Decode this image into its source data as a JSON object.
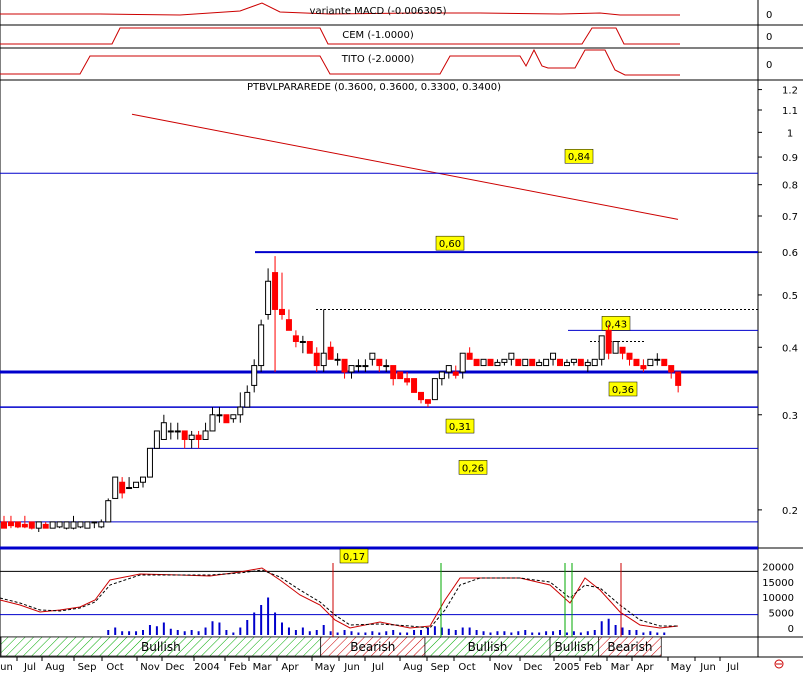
{
  "indicators": [
    {
      "label": "variante MACD (-0.006305)",
      "value": "0"
    },
    {
      "label": "CEM (-1.0000)",
      "value": "0"
    },
    {
      "label": "TITO (-2.0000)",
      "value": "0"
    }
  ],
  "chart_data": {
    "type": "candlestick",
    "title": "PTBVLPARAREDE (0.3600, 0.3600, 0.3300, 0.3400)",
    "y_scale": "log",
    "ylim": [
      0.17,
      1.25
    ],
    "y_ticks": [
      "1.2",
      "1.1",
      "1",
      "0.9",
      "0.8",
      "0.7",
      "0.6",
      "0.5",
      "0.4",
      "0.3",
      "0.2"
    ],
    "x_labels": [
      "Jun",
      "Jul",
      "Aug",
      "Sep",
      "Oct",
      "Nov",
      "Dec",
      "2004",
      "Feb",
      "Mar",
      "Apr",
      "May",
      "Jun",
      "Jul",
      "Aug",
      "Sep",
      "Oct",
      "Nov",
      "Dec",
      "2005",
      "Feb",
      "Mar",
      "Apr",
      "May",
      "Jun",
      "Jul"
    ],
    "level_labels": [
      "0,84",
      "0,60",
      "0,43",
      "0,36",
      "0,31",
      "0,26",
      "0,17"
    ],
    "candles": [
      {
        "o": 0.19,
        "h": 0.195,
        "l": 0.185,
        "c": 0.185
      },
      {
        "o": 0.19,
        "h": 0.195,
        "l": 0.185,
        "c": 0.187
      },
      {
        "o": 0.19,
        "h": 0.19,
        "l": 0.185,
        "c": 0.186
      },
      {
        "o": 0.188,
        "h": 0.195,
        "l": 0.185,
        "c": 0.186
      },
      {
        "o": 0.19,
        "h": 0.19,
        "l": 0.184,
        "c": 0.185
      },
      {
        "o": 0.185,
        "h": 0.19,
        "l": 0.182,
        "c": 0.19
      },
      {
        "o": 0.188,
        "h": 0.19,
        "l": 0.185,
        "c": 0.185
      },
      {
        "o": 0.185,
        "h": 0.19,
        "l": 0.185,
        "c": 0.19
      },
      {
        "o": 0.186,
        "h": 0.19,
        "l": 0.185,
        "c": 0.19
      },
      {
        "o": 0.185,
        "h": 0.19,
        "l": 0.184,
        "c": 0.19
      },
      {
        "o": 0.185,
        "h": 0.195,
        "l": 0.184,
        "c": 0.19
      },
      {
        "o": 0.186,
        "h": 0.19,
        "l": 0.185,
        "c": 0.19
      },
      {
        "o": 0.185,
        "h": 0.19,
        "l": 0.185,
        "c": 0.19
      },
      {
        "o": 0.19,
        "h": 0.19,
        "l": 0.185,
        "c": 0.19
      },
      {
        "o": 0.186,
        "h": 0.192,
        "l": 0.185,
        "c": 0.19
      },
      {
        "o": 0.19,
        "h": 0.21,
        "l": 0.19,
        "c": 0.208
      },
      {
        "o": 0.21,
        "h": 0.23,
        "l": 0.21,
        "c": 0.23
      },
      {
        "o": 0.225,
        "h": 0.23,
        "l": 0.21,
        "c": 0.215
      },
      {
        "o": 0.22,
        "h": 0.23,
        "l": 0.22,
        "c": 0.22
      },
      {
        "o": 0.22,
        "h": 0.225,
        "l": 0.22,
        "c": 0.225
      },
      {
        "o": 0.225,
        "h": 0.23,
        "l": 0.22,
        "c": 0.23
      },
      {
        "o": 0.23,
        "h": 0.26,
        "l": 0.23,
        "c": 0.26
      },
      {
        "o": 0.26,
        "h": 0.28,
        "l": 0.26,
        "c": 0.28
      },
      {
        "o": 0.27,
        "h": 0.3,
        "l": 0.27,
        "c": 0.29
      },
      {
        "o": 0.28,
        "h": 0.29,
        "l": 0.27,
        "c": 0.28
      },
      {
        "o": 0.28,
        "h": 0.29,
        "l": 0.27,
        "c": 0.28
      },
      {
        "o": 0.28,
        "h": 0.28,
        "l": 0.26,
        "c": 0.27
      },
      {
        "o": 0.27,
        "h": 0.28,
        "l": 0.26,
        "c": 0.275
      },
      {
        "o": 0.275,
        "h": 0.28,
        "l": 0.26,
        "c": 0.27
      },
      {
        "o": 0.27,
        "h": 0.29,
        "l": 0.27,
        "c": 0.28
      },
      {
        "o": 0.28,
        "h": 0.31,
        "l": 0.28,
        "c": 0.3
      },
      {
        "o": 0.3,
        "h": 0.31,
        "l": 0.29,
        "c": 0.3
      },
      {
        "o": 0.3,
        "h": 0.3,
        "l": 0.29,
        "c": 0.29
      },
      {
        "o": 0.295,
        "h": 0.3,
        "l": 0.29,
        "c": 0.3
      },
      {
        "o": 0.3,
        "h": 0.33,
        "l": 0.29,
        "c": 0.31
      },
      {
        "o": 0.31,
        "h": 0.34,
        "l": 0.31,
        "c": 0.33
      },
      {
        "o": 0.34,
        "h": 0.38,
        "l": 0.33,
        "c": 0.37
      },
      {
        "o": 0.37,
        "h": 0.45,
        "l": 0.36,
        "c": 0.44
      },
      {
        "o": 0.46,
        "h": 0.56,
        "l": 0.45,
        "c": 0.53
      },
      {
        "o": 0.55,
        "h": 0.59,
        "l": 0.36,
        "c": 0.47
      },
      {
        "o": 0.47,
        "h": 0.55,
        "l": 0.45,
        "c": 0.46
      },
      {
        "o": 0.45,
        "h": 0.47,
        "l": 0.43,
        "c": 0.43
      },
      {
        "o": 0.42,
        "h": 0.43,
        "l": 0.4,
        "c": 0.41
      },
      {
        "o": 0.41,
        "h": 0.42,
        "l": 0.39,
        "c": 0.41
      },
      {
        "o": 0.41,
        "h": 0.41,
        "l": 0.39,
        "c": 0.39
      },
      {
        "o": 0.39,
        "h": 0.4,
        "l": 0.36,
        "c": 0.37
      },
      {
        "o": 0.37,
        "h": 0.47,
        "l": 0.36,
        "c": 0.39
      },
      {
        "o": 0.4,
        "h": 0.41,
        "l": 0.38,
        "c": 0.38
      },
      {
        "o": 0.38,
        "h": 0.39,
        "l": 0.37,
        "c": 0.38
      },
      {
        "o": 0.38,
        "h": 0.38,
        "l": 0.35,
        "c": 0.36
      },
      {
        "o": 0.36,
        "h": 0.37,
        "l": 0.35,
        "c": 0.37
      },
      {
        "o": 0.37,
        "h": 0.38,
        "l": 0.36,
        "c": 0.37
      },
      {
        "o": 0.37,
        "h": 0.38,
        "l": 0.36,
        "c": 0.37
      },
      {
        "o": 0.38,
        "h": 0.39,
        "l": 0.37,
        "c": 0.39
      },
      {
        "o": 0.38,
        "h": 0.38,
        "l": 0.36,
        "c": 0.37
      },
      {
        "o": 0.37,
        "h": 0.38,
        "l": 0.36,
        "c": 0.37
      },
      {
        "o": 0.37,
        "h": 0.37,
        "l": 0.34,
        "c": 0.35
      },
      {
        "o": 0.36,
        "h": 0.36,
        "l": 0.35,
        "c": 0.35
      },
      {
        "o": 0.35,
        "h": 0.36,
        "l": 0.34,
        "c": 0.345
      },
      {
        "o": 0.35,
        "h": 0.35,
        "l": 0.33,
        "c": 0.33
      },
      {
        "o": 0.33,
        "h": 0.33,
        "l": 0.315,
        "c": 0.32
      },
      {
        "o": 0.32,
        "h": 0.32,
        "l": 0.31,
        "c": 0.315
      },
      {
        "o": 0.32,
        "h": 0.35,
        "l": 0.32,
        "c": 0.35
      },
      {
        "o": 0.35,
        "h": 0.36,
        "l": 0.34,
        "c": 0.36
      },
      {
        "o": 0.36,
        "h": 0.37,
        "l": 0.35,
        "c": 0.37
      },
      {
        "o": 0.36,
        "h": 0.37,
        "l": 0.35,
        "c": 0.355
      },
      {
        "o": 0.36,
        "h": 0.39,
        "l": 0.35,
        "c": 0.39
      },
      {
        "o": 0.39,
        "h": 0.4,
        "l": 0.38,
        "c": 0.38
      },
      {
        "o": 0.38,
        "h": 0.38,
        "l": 0.37,
        "c": 0.37
      },
      {
        "o": 0.37,
        "h": 0.38,
        "l": 0.37,
        "c": 0.38
      },
      {
        "o": 0.38,
        "h": 0.38,
        "l": 0.37,
        "c": 0.37
      },
      {
        "o": 0.37,
        "h": 0.38,
        "l": 0.37,
        "c": 0.375
      },
      {
        "o": 0.375,
        "h": 0.38,
        "l": 0.37,
        "c": 0.38
      },
      {
        "o": 0.38,
        "h": 0.39,
        "l": 0.37,
        "c": 0.39
      },
      {
        "o": 0.38,
        "h": 0.38,
        "l": 0.37,
        "c": 0.37
      },
      {
        "o": 0.37,
        "h": 0.38,
        "l": 0.37,
        "c": 0.38
      },
      {
        "o": 0.38,
        "h": 0.38,
        "l": 0.37,
        "c": 0.37
      },
      {
        "o": 0.37,
        "h": 0.38,
        "l": 0.37,
        "c": 0.375
      },
      {
        "o": 0.37,
        "h": 0.38,
        "l": 0.37,
        "c": 0.38
      },
      {
        "o": 0.38,
        "h": 0.39,
        "l": 0.37,
        "c": 0.39
      },
      {
        "o": 0.38,
        "h": 0.38,
        "l": 0.37,
        "c": 0.37
      },
      {
        "o": 0.37,
        "h": 0.38,
        "l": 0.37,
        "c": 0.375
      },
      {
        "o": 0.375,
        "h": 0.38,
        "l": 0.37,
        "c": 0.38
      },
      {
        "o": 0.38,
        "h": 0.38,
        "l": 0.37,
        "c": 0.37
      },
      {
        "o": 0.37,
        "h": 0.38,
        "l": 0.36,
        "c": 0.375
      },
      {
        "o": 0.37,
        "h": 0.38,
        "l": 0.37,
        "c": 0.38
      },
      {
        "o": 0.38,
        "h": 0.42,
        "l": 0.37,
        "c": 0.42
      },
      {
        "o": 0.43,
        "h": 0.44,
        "l": 0.38,
        "c": 0.39
      },
      {
        "o": 0.39,
        "h": 0.41,
        "l": 0.39,
        "c": 0.41
      },
      {
        "o": 0.4,
        "h": 0.4,
        "l": 0.38,
        "c": 0.39
      },
      {
        "o": 0.39,
        "h": 0.39,
        "l": 0.37,
        "c": 0.38
      },
      {
        "o": 0.38,
        "h": 0.38,
        "l": 0.37,
        "c": 0.37
      },
      {
        "o": 0.37,
        "h": 0.38,
        "l": 0.36,
        "c": 0.365
      },
      {
        "o": 0.37,
        "h": 0.38,
        "l": 0.37,
        "c": 0.38
      },
      {
        "o": 0.38,
        "h": 0.39,
        "l": 0.37,
        "c": 0.38
      },
      {
        "o": 0.38,
        "h": 0.38,
        "l": 0.37,
        "c": 0.37
      },
      {
        "o": 0.37,
        "h": 0.37,
        "l": 0.35,
        "c": 0.36
      },
      {
        "o": 0.36,
        "h": 0.36,
        "l": 0.33,
        "c": 0.34
      }
    ],
    "level_lines": [
      0.84,
      0.6,
      0.36,
      0.31,
      0.26,
      0.19,
      0.17
    ],
    "bottom_panel": {
      "y_ticks": [
        "20000",
        "15000",
        "10000",
        "5000",
        "0"
      ],
      "overbought": 20000,
      "oversold": 5000,
      "zones": [
        {
          "label": "Bullish",
          "from": 0,
          "to": 46
        },
        {
          "label": "Bearish",
          "from": 46,
          "to": 61
        },
        {
          "label": "Bullish",
          "from": 61,
          "to": 79
        },
        {
          "label": "Bullish",
          "from": 79,
          "to": 86
        },
        {
          "label": "Bearish",
          "from": 86,
          "to": 95
        }
      ]
    }
  },
  "colors": {
    "candle_down": "#ff0000",
    "candle_up_fill": "#ffffff",
    "level_line": "#0000cc",
    "trend_line": "#cc0000",
    "label_box": "#ffff00"
  }
}
